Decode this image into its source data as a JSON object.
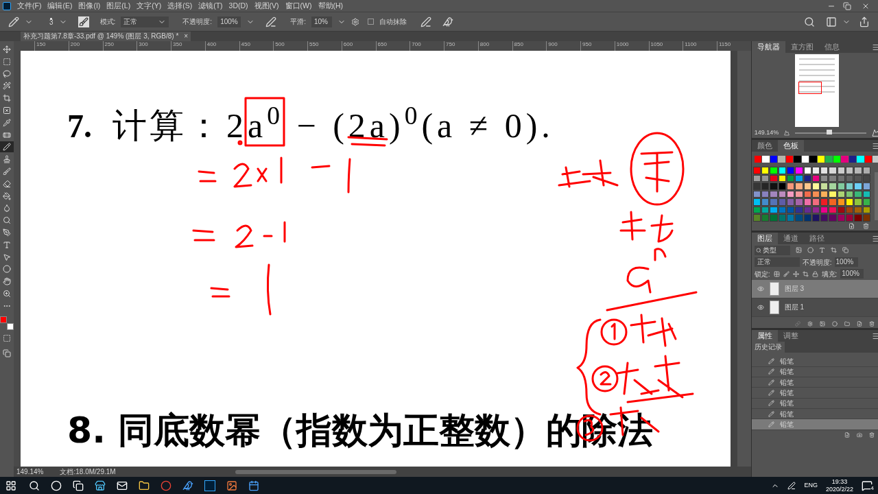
{
  "menu_bar": {
    "items": [
      "文件(F)",
      "编辑(E)",
      "图像(I)",
      "图层(L)",
      "文字(Y)",
      "选择(S)",
      "滤镜(T)",
      "3D(D)",
      "视图(V)",
      "窗口(W)",
      "帮助(H)"
    ]
  },
  "options_bar": {
    "brush_size": "3",
    "mode_label": "模式:",
    "mode_value": "正常",
    "opacity_label": "不透明度:",
    "opacity_value": "100%",
    "smoothing_label": "平滑:",
    "smoothing_value": "10%",
    "auto_erase": {
      "label": "自动抹除",
      "checked": false
    }
  },
  "document_tab": {
    "title": "补充习题第7.8章-33.pdf @ 149% (图层 3, RGB/8) *",
    "close": "×"
  },
  "tools": [
    {
      "selected": false
    },
    {
      "selected": false
    },
    {
      "selected": false
    },
    {
      "selected": false
    },
    {
      "selected": false
    },
    {
      "selected": false
    },
    {
      "selected": false
    },
    {
      "selected": false
    },
    {
      "selected": true
    },
    {
      "selected": false
    },
    {
      "selected": false
    },
    {
      "selected": false
    },
    {
      "selected": false
    },
    {
      "selected": false
    },
    {
      "selected": false
    },
    {
      "selected": false
    },
    {
      "selected": false
    },
    {
      "selected": false
    },
    {
      "selected": false
    },
    {
      "selected": false
    },
    {
      "selected": false
    },
    {
      "selected": false
    }
  ],
  "colors": {
    "foreground": {
      "color": "#ff0000"
    },
    "background": {
      "color": "#ffffff"
    }
  },
  "ruler_labels": [
    "150",
    "200",
    "250",
    "300",
    "350",
    "400",
    "450",
    "500",
    "550",
    "600",
    "650",
    "700",
    "750",
    "800",
    "850",
    "900",
    "950",
    "1000",
    "1050",
    "1100",
    "1150"
  ],
  "document": {
    "problem_7": {
      "number": "7.",
      "title": "计算：",
      "formula": "2a$^{0}$ − (2a)$^{0}$(a ≠ 0)."
    },
    "problem_8": "8. 同底数幂（指数为正整数）的除法"
  },
  "status_bar": {
    "zoom": "149.14%",
    "doc_size": "文档:18.0M/29.1M"
  },
  "navigator": {
    "tabs": [
      {
        "label": "导航器",
        "selected": true
      },
      {
        "label": "直方图",
        "selected": false
      },
      {
        "label": "信息",
        "selected": false
      }
    ],
    "zoom": "149.14%",
    "level": 0.48
  },
  "swatches_panel": {
    "tabs": [
      {
        "label": "颜色",
        "selected": false
      },
      {
        "label": "色板",
        "selected": true
      }
    ],
    "recent": [
      {
        "color": "#ff0000"
      },
      {
        "color": "#ffffff"
      },
      {
        "color": "#0000ff"
      },
      {
        "color": "#b4b4aa"
      },
      {
        "color": "#ff0000"
      },
      {
        "color": "#000000"
      },
      {
        "color": "#ffffff"
      },
      {
        "color": "#000000"
      },
      {
        "color": "#ffff00"
      },
      {
        "color": "#22b14c"
      },
      {
        "color": "#00ff00"
      },
      {
        "color": "#e4007f"
      },
      {
        "color": "#1d2088"
      },
      {
        "color": "#00ffff"
      },
      {
        "color": "#ff0000"
      },
      {
        "color": "#c8c8c8"
      }
    ],
    "grid": [
      {
        "color": "#ff0000"
      },
      {
        "color": "#ffff00"
      },
      {
        "color": "#00ff00"
      },
      {
        "color": "#00ffff"
      },
      {
        "color": "#0000ff"
      },
      {
        "color": "#ff00ff"
      },
      {
        "color": "#ffffff"
      },
      {
        "color": "#ebebeb"
      },
      {
        "color": "#e1e1e1"
      },
      {
        "color": "#d7d7d7"
      },
      {
        "color": "#cccccc"
      },
      {
        "color": "#c2c2c2"
      },
      {
        "color": "#b7b7b7"
      },
      {
        "color": "#acacac"
      },
      {
        "color": "#a0a0a0"
      },
      {
        "color": "#959595"
      },
      {
        "color": "#e5001b"
      },
      {
        "color": "#fff100"
      },
      {
        "color": "#009944"
      },
      {
        "color": "#00a0e9"
      },
      {
        "color": "#1d2088"
      },
      {
        "color": "#e4007f"
      },
      {
        "color": "#898989"
      },
      {
        "color": "#7d7d7d"
      },
      {
        "color": "#707070"
      },
      {
        "color": "#626262"
      },
      {
        "color": "#555555"
      },
      {
        "color": "#464646"
      },
      {
        "color": "#363636"
      },
      {
        "color": "#262626"
      },
      {
        "color": "#111111"
      },
      {
        "color": "#000000"
      },
      {
        "color": "#f7977a"
      },
      {
        "color": "#fbad82"
      },
      {
        "color": "#fdc68c"
      },
      {
        "color": "#fff799"
      },
      {
        "color": "#c6df9c"
      },
      {
        "color": "#a4d49d"
      },
      {
        "color": "#81ca9d"
      },
      {
        "color": "#7bcdc9"
      },
      {
        "color": "#6ccff7"
      },
      {
        "color": "#7ca6d8"
      },
      {
        "color": "#8293ca"
      },
      {
        "color": "#8881be"
      },
      {
        "color": "#a286bd"
      },
      {
        "color": "#bc8cbf"
      },
      {
        "color": "#f49bc1"
      },
      {
        "color": "#f5999d"
      },
      {
        "color": "#f16c4d"
      },
      {
        "color": "#f68e54"
      },
      {
        "color": "#fbaf5a"
      },
      {
        "color": "#fff467"
      },
      {
        "color": "#acd372"
      },
      {
        "color": "#7dc473"
      },
      {
        "color": "#39b778"
      },
      {
        "color": "#16bcb4"
      },
      {
        "color": "#00bff3"
      },
      {
        "color": "#438ccb"
      },
      {
        "color": "#5573b7"
      },
      {
        "color": "#5e5ca7"
      },
      {
        "color": "#855fa8"
      },
      {
        "color": "#a763a9"
      },
      {
        "color": "#ef6ea8"
      },
      {
        "color": "#f16d7e"
      },
      {
        "color": "#ee1d24"
      },
      {
        "color": "#f16522"
      },
      {
        "color": "#f7941d"
      },
      {
        "color": "#fff100"
      },
      {
        "color": "#8fc63d"
      },
      {
        "color": "#37b44a"
      },
      {
        "color": "#00a650"
      },
      {
        "color": "#00a99e"
      },
      {
        "color": "#00aeef"
      },
      {
        "color": "#0072bc"
      },
      {
        "color": "#0054a5"
      },
      {
        "color": "#2f3192"
      },
      {
        "color": "#652c91"
      },
      {
        "color": "#91278f"
      },
      {
        "color": "#ed008c"
      },
      {
        "color": "#ee105a"
      },
      {
        "color": "#9d0a0f"
      },
      {
        "color": "#a1410d"
      },
      {
        "color": "#a36209"
      },
      {
        "color": "#aba000"
      },
      {
        "color": "#588528"
      },
      {
        "color": "#197b30"
      },
      {
        "color": "#007236"
      },
      {
        "color": "#00736a"
      },
      {
        "color": "#0076a4"
      },
      {
        "color": "#004a80"
      },
      {
        "color": "#003370"
      },
      {
        "color": "#1d1363"
      },
      {
        "color": "#450e61"
      },
      {
        "color": "#62055f"
      },
      {
        "color": "#9e005c"
      },
      {
        "color": "#9d0039"
      },
      {
        "color": "#790000"
      },
      {
        "color": "#7b3000"
      }
    ]
  },
  "layers_panel": {
    "tabs": [
      {
        "label": "图层",
        "selected": true
      },
      {
        "label": "通道",
        "selected": false
      },
      {
        "label": "路径",
        "selected": false
      }
    ],
    "filter": "类型",
    "blend_mode": "正常",
    "opacity_label": "不透明度:",
    "opacity_value": "100%",
    "lock_label": "锁定:",
    "fill_label": "填充:",
    "fill_value": "100%",
    "layers": [
      {
        "name": "图层 3",
        "visible": true,
        "selected": true
      },
      {
        "name": "图层 1",
        "visible": true,
        "selected": false
      }
    ]
  },
  "properties_panel": {
    "tabs": [
      {
        "label": "属性",
        "selected": true
      },
      {
        "label": "调整",
        "selected": false
      }
    ]
  },
  "history_panel": {
    "title": "历史记录",
    "items": [
      {
        "label": "铅笔",
        "selected": false
      },
      {
        "label": "铅笔",
        "selected": false
      },
      {
        "label": "铅笔",
        "selected": false
      },
      {
        "label": "铅笔",
        "selected": false
      },
      {
        "label": "铅笔",
        "selected": false
      },
      {
        "label": "铅笔",
        "selected": false
      },
      {
        "label": "铅笔",
        "selected": true
      }
    ]
  },
  "taskbar": {
    "language": "ENG",
    "time": "19:33",
    "date": "2020/2/22",
    "notifications": "4"
  }
}
